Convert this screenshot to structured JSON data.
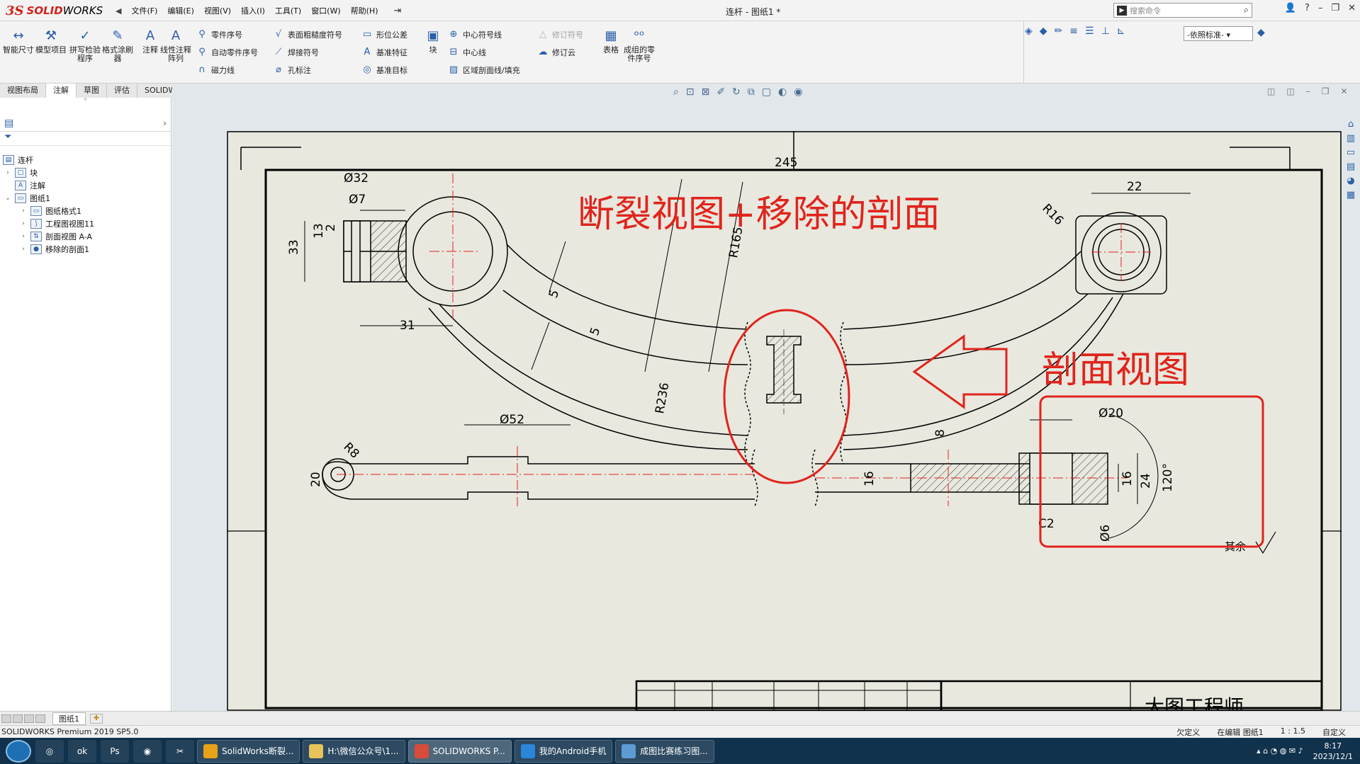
{
  "app": {
    "logo_ds": "3S",
    "logo_solid": "SOLID",
    "logo_works": "WORKS",
    "document_title": "连杆 - 图纸1 *"
  },
  "menu": {
    "items": [
      "文件(F)",
      "编辑(E)",
      "视图(V)",
      "插入(I)",
      "工具(T)",
      "窗口(W)",
      "帮助(H)"
    ]
  },
  "search": {
    "placeholder": "搜索命令"
  },
  "ribbon": {
    "smart_dim": "智能尺寸",
    "model_items": "模型项目",
    "spell_check": "拼写检验程序",
    "format_painter": "格式涂刷器",
    "note": "注释",
    "linear_note": "线性注释阵列",
    "balloon": "零件序号",
    "auto_balloon": "自动零件序号",
    "magnetic_line": "磁力线",
    "surface_finish": "表面粗糙度符号",
    "weld_symbol": "焊接符号",
    "hole_callout": "孔标注",
    "gtol": "形位公差",
    "datum_feature": "基准特征",
    "datum_target": "基准目标",
    "block": "块",
    "center_mark": "中心符号线",
    "centerline": "中心线",
    "hatch": "区域剖面线/填充",
    "revision_symbol": "修订符号",
    "revision_cloud": "修订云",
    "table": "表格",
    "grouped_balloon": "成组的零件序号",
    "standard": "-依照标准-"
  },
  "tabs": [
    "视图布局",
    "注解",
    "草图",
    "评估",
    "SOLIDWORKS 插件"
  ],
  "active_tab": "注解",
  "tree": {
    "root": "连杆",
    "items": [
      {
        "label": "块",
        "level": 1
      },
      {
        "label": "注解",
        "level": 1
      },
      {
        "label": "图纸1",
        "level": 1
      },
      {
        "label": "图纸格式1",
        "level": 2
      },
      {
        "label": "工程图视图11",
        "level": 2
      },
      {
        "label": "剖面视图 A-A",
        "level": 2
      },
      {
        "label": "移除的剖面1",
        "level": 2
      }
    ]
  },
  "drawing": {
    "annotation_main": "断裂视图+移除的剖面",
    "annotation_section": "剖面视图",
    "dims": {
      "d32": "Ø32",
      "d7": "Ø7",
      "d245": "245",
      "d22": "22",
      "r16": "R16",
      "d13": "13",
      "d2": "2",
      "d33": "33",
      "r165": "R165",
      "d5a": "5",
      "d5b": "5",
      "r236": "R236",
      "d31": "31",
      "d52": "Ø52",
      "r8": "R8",
      "d20": "20",
      "d8": "8",
      "d16a": "16",
      "d20b": "Ø20",
      "d16b": "16",
      "d24": "24",
      "a120": "120°",
      "c2": "C2",
      "d6": "Ø6",
      "other": "其余"
    },
    "title_block_partial": "大图工程师"
  },
  "sheet_tab": "图纸1",
  "status": {
    "product": "SOLIDWORKS Premium 2019 SP5.0",
    "under_defined": "欠定义",
    "editing": "在编辑 图纸1",
    "scale": "1 : 1.5",
    "custom": "自定义"
  },
  "taskbar": {
    "apps": [
      "SolidWorks断裂...",
      "H:\\微信公众号\\1...",
      "SOLIDWORKS P...",
      "我的Android手机",
      "成图比赛练习图..."
    ],
    "time": "8:17",
    "date": "2023/12/1"
  },
  "colors": {
    "accent_red": "#e0241c",
    "sheet_bg": "#e8e8df",
    "taskbar": "#11324d"
  }
}
